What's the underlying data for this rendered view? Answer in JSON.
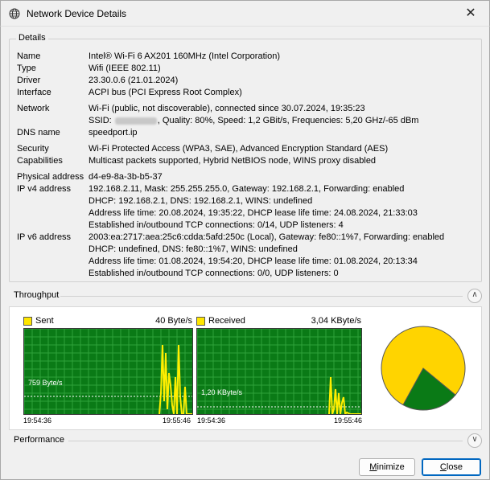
{
  "window": {
    "title": "Network Device Details",
    "close_glyph": "✕",
    "icon": "globe-icon"
  },
  "details": {
    "group_label": "Details",
    "rows": [
      {
        "label": "Name",
        "value": "Intel® Wi-Fi 6 AX201 160MHz (Intel Corporation)"
      },
      {
        "label": "Type",
        "value": "Wifi (IEEE 802.11)"
      },
      {
        "label": "Driver",
        "value": "23.30.0.6 (21.01.2024)"
      },
      {
        "label": "Interface",
        "value": "ACPI bus (PCI Express Root Complex)"
      },
      {
        "label": "Network",
        "value": "Wi-Fi (public, not discoverable), connected since 30.07.2024, 19:35:23"
      },
      {
        "label": "",
        "value_pre": "SSID:",
        "value_post": ", Quality: 80%, Speed: 1,2 GBit/s, Frequencies: 5,20 GHz/-65 dBm"
      },
      {
        "label": "DNS name",
        "value": "speedport.ip"
      },
      {
        "label": "Security",
        "value": "Wi-Fi Protected Access (WPA3, SAE), Advanced Encryption Standard (AES)"
      },
      {
        "label": "Capabilities",
        "value": "Multicast packets supported, Hybrid NetBIOS node, WINS proxy disabled"
      },
      {
        "label": "Physical address",
        "value": "d4-e9-8a-3b-b5-37"
      },
      {
        "label": "IP v4 address",
        "value": "192.168.2.11, Mask: 255.255.255.0, Gateway: 192.168.2.1, Forwarding: enabled"
      },
      {
        "label": "",
        "value": "DHCP: 192.168.2.1, DNS: 192.168.2.1, WINS: undefined"
      },
      {
        "label": "",
        "value": "Address life time: 20.08.2024, 19:35:22, DHCP lease life time: 24.08.2024, 21:33:03"
      },
      {
        "label": "",
        "value": "Established in/outbound TCP connections: 0/14, UDP listeners: 4"
      },
      {
        "label": "IP v6 address",
        "value": "2003:ea:2717:aea:25c6:cdda:5afd:250c (Local), Gateway: fe80::1%7, Forwarding: enabled"
      },
      {
        "label": "",
        "value": "DHCP: undefined, DNS: fe80::1%7, WINS: undefined"
      },
      {
        "label": "",
        "value": "Address life time: 01.08.2024, 19:54:20, DHCP lease life time: 01.08.2024, 20:13:34"
      },
      {
        "label": "",
        "value": "Established in/outbound TCP connections: 0/0, UDP listeners: 0"
      }
    ]
  },
  "throughput": {
    "label": "Throughput",
    "chevron": "∧",
    "sent": {
      "legend": "Sent",
      "rate": "40 Byte/s",
      "avg_label": "759 Byte/s",
      "time_start": "19:54:36",
      "time_end": "19:55:46",
      "color": "#ffe600"
    },
    "received": {
      "legend": "Received",
      "rate": "3,04 KByte/s",
      "avg_label": "1,20 KByte/s",
      "time_start": "19:54:36",
      "time_end": "19:55:46",
      "color": "#ffe600"
    },
    "pie": {
      "sent_share": 0.22,
      "received_share": 0.78,
      "sent_color": "#0a7a16",
      "received_color": "#ffd400"
    }
  },
  "performance": {
    "label": "Performance",
    "chevron": "∨"
  },
  "buttons": {
    "minimize_key": "M",
    "minimize_rest": "inimize",
    "close_key": "C",
    "close_rest": "lose"
  }
}
